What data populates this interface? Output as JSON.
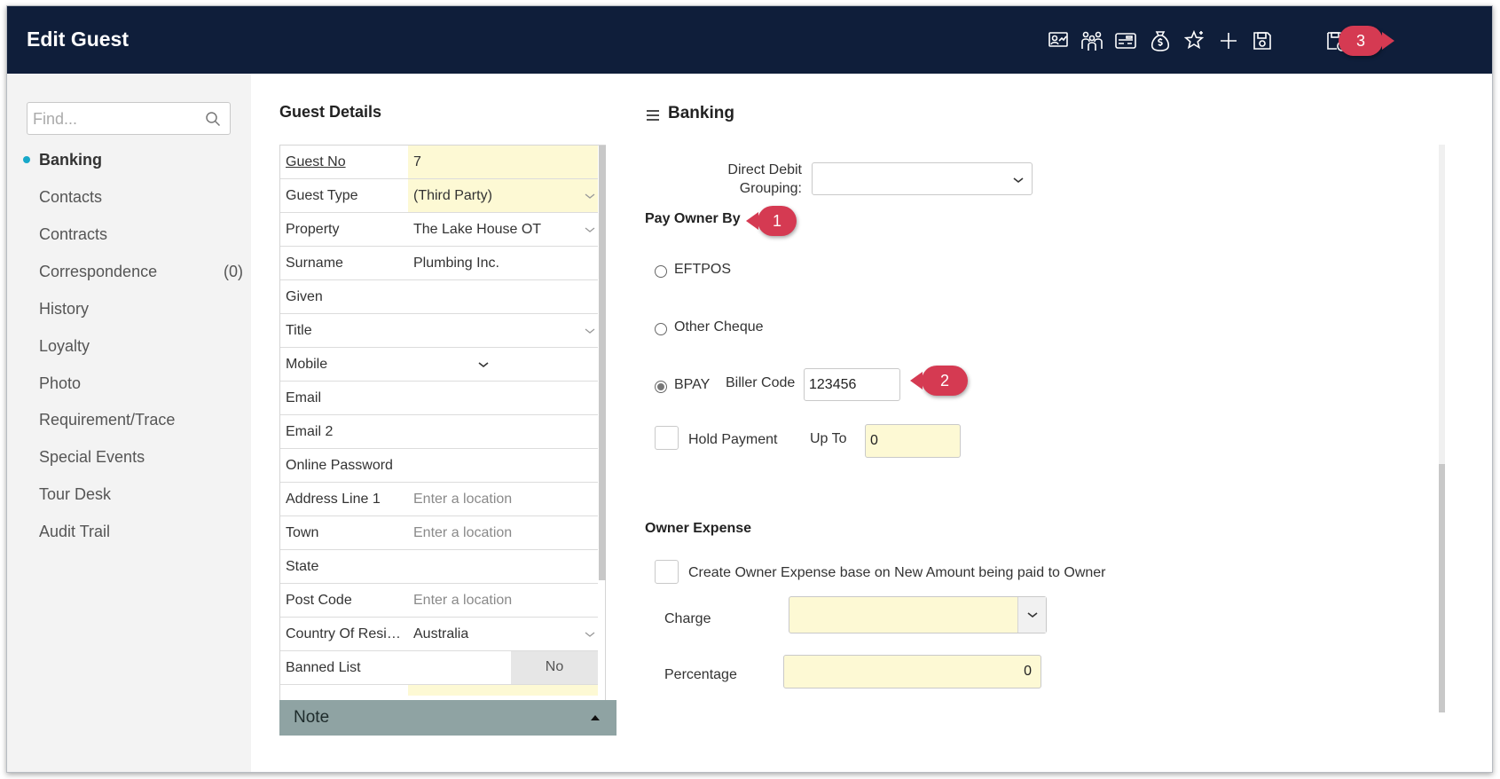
{
  "window": {
    "title": "Edit Guest"
  },
  "toolbar": {
    "icons": [
      "owner-statement-icon",
      "guests-group-icon",
      "id-card-icon",
      "money-bag-icon",
      "star-icon",
      "add-icon",
      "save-icon",
      "save-close-icon",
      "close-icon"
    ]
  },
  "sidebar": {
    "search_placeholder": "Find...",
    "items": [
      {
        "label": "Banking",
        "active": true
      },
      {
        "label": "Contacts"
      },
      {
        "label": "Contracts"
      },
      {
        "label": "Correspondence",
        "count": "(0)"
      },
      {
        "label": "History"
      },
      {
        "label": "Loyalty"
      },
      {
        "label": "Photo"
      },
      {
        "label": "Requirement/Trace"
      },
      {
        "label": "Special Events"
      },
      {
        "label": "Tour Desk"
      },
      {
        "label": "Audit Trail"
      }
    ]
  },
  "guest_details": {
    "title": "Guest Details",
    "rows": [
      {
        "label": "Guest No",
        "value": "7"
      },
      {
        "label": "Guest Type",
        "value": "(Third Party)"
      },
      {
        "label": "Property",
        "value": "The Lake House OT"
      },
      {
        "label": "Surname",
        "value": "Plumbing Inc."
      },
      {
        "label": "Given",
        "value": ""
      },
      {
        "label": "Title",
        "value": ""
      },
      {
        "label": "Mobile",
        "value": ""
      },
      {
        "label": "Email",
        "value": ""
      },
      {
        "label": "Email 2",
        "value": ""
      },
      {
        "label": "Online Password",
        "value": ""
      },
      {
        "label": "Address Line 1",
        "value": "Enter a location"
      },
      {
        "label": "Town",
        "value": "Enter a location"
      },
      {
        "label": "State",
        "value": ""
      },
      {
        "label": "Post Code",
        "value": "Enter a location"
      },
      {
        "label": "Country Of Reside...",
        "value": "Australia"
      },
      {
        "label": "Banned List",
        "value": "No"
      }
    ],
    "note_label": "Note"
  },
  "banking": {
    "title": "Banking",
    "direct_debit_label_1": "Direct Debit",
    "direct_debit_label_2": "Grouping:",
    "direct_debit_value": "",
    "pay_owner_by": "Pay Owner By",
    "options": [
      "EFTPOS",
      "Other Cheque",
      "BPAY"
    ],
    "selected_option": "BPAY",
    "biller_code_label": "Biller Code",
    "biller_code_value": "123456",
    "hold_payment_label": "Hold Payment",
    "up_to_label": "Up To",
    "up_to_value": "0",
    "owner_expense_title": "Owner Expense",
    "create_owner_expense_label": "Create Owner Expense base on New Amount being paid to Owner",
    "charge_label": "Charge",
    "charge_value": "",
    "percentage_label": "Percentage",
    "percentage_value": "0"
  },
  "callouts": [
    "1",
    "2",
    "3"
  ],
  "colors": {
    "titlebar": "#0f1e3a",
    "accent": "#17a8c9",
    "callout": "#d53a52",
    "required_field": "#fdf9d4",
    "note_bar": "#8fa3a3"
  }
}
